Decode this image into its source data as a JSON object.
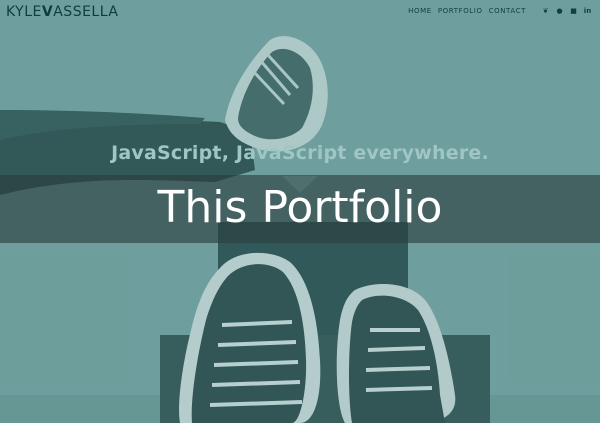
{
  "header": {
    "brand_part1": "KYLE",
    "brand_part2": "V",
    "brand_part3": "ASSELLA",
    "nav": [
      {
        "label": "HOME"
      },
      {
        "label": "PORTFOLIO"
      },
      {
        "label": "CONTACT"
      }
    ],
    "social": [
      {
        "icon": "apple-icon",
        "glyph": "❦"
      },
      {
        "icon": "github-icon",
        "glyph": "●"
      },
      {
        "icon": "package-icon",
        "glyph": "■"
      },
      {
        "icon": "linkedin-icon",
        "glyph": "in"
      }
    ]
  },
  "hero": {
    "tagline": "JavaScript, JavaScript everywhere.",
    "title": "This Portfolio"
  },
  "colors": {
    "overlay": "#5c9694",
    "banner": "#2a3e3e",
    "text_dark": "#123c3b",
    "tagline": "#9fc6c4"
  }
}
